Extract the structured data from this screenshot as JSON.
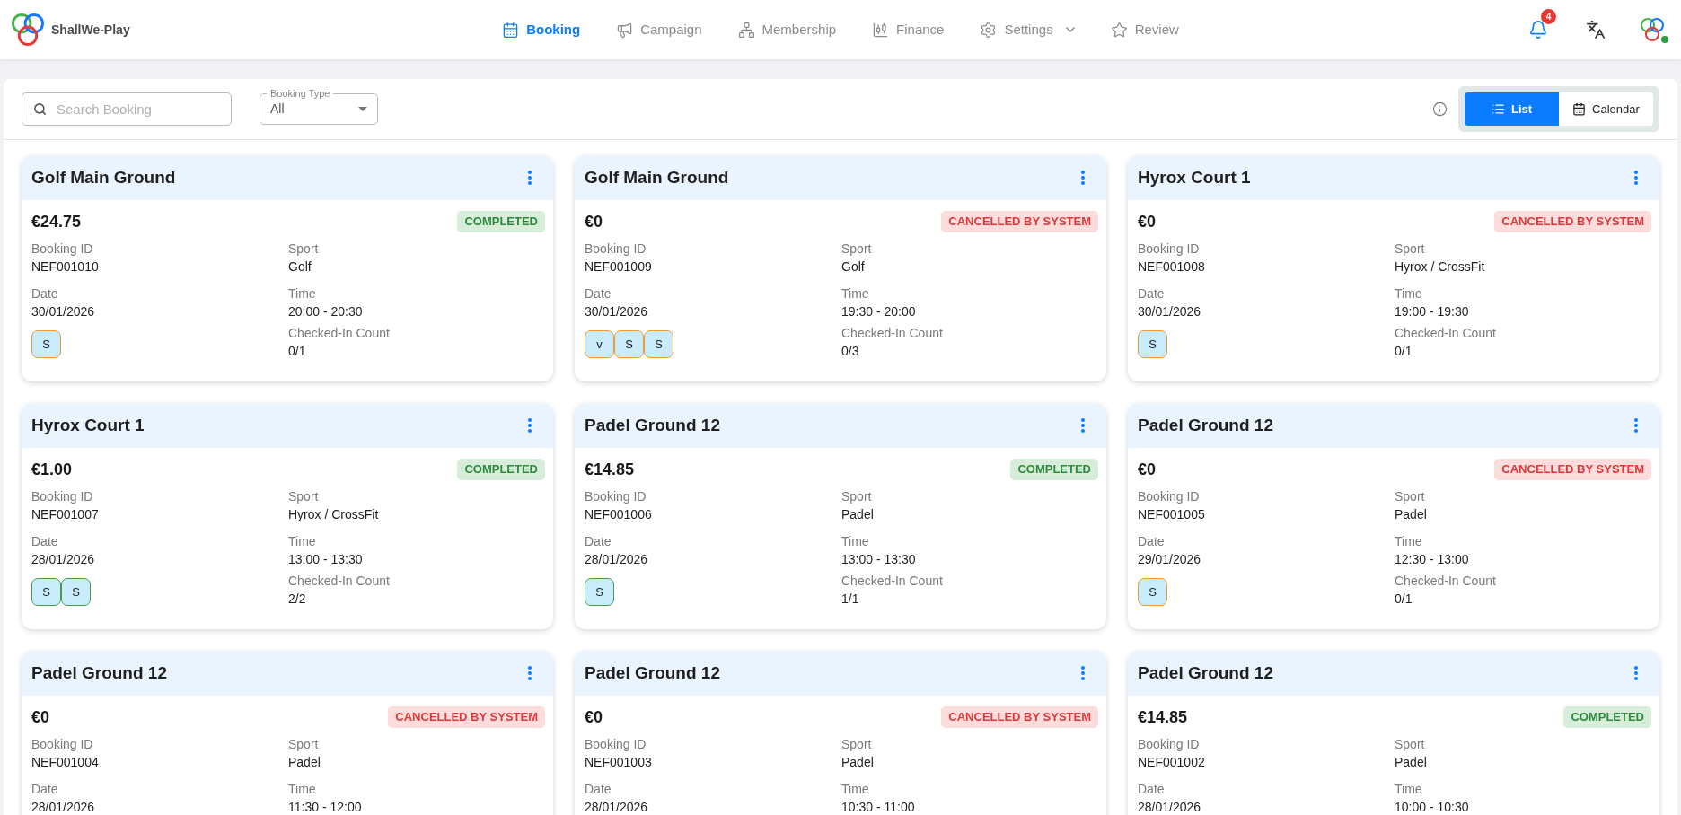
{
  "app": {
    "brand": "ShallWe-Play"
  },
  "nav": [
    {
      "label": "Booking",
      "selected": true,
      "dropdown": false
    },
    {
      "label": "Campaign",
      "selected": false,
      "dropdown": false
    },
    {
      "label": "Membership",
      "selected": false,
      "dropdown": false
    },
    {
      "label": "Finance",
      "selected": false,
      "dropdown": false
    },
    {
      "label": "Settings",
      "selected": false,
      "dropdown": true
    },
    {
      "label": "Review",
      "selected": false,
      "dropdown": false
    }
  ],
  "header_actions": {
    "notifications": {
      "count": "4"
    },
    "avatar": {
      "online": true
    }
  },
  "toolbar": {
    "search": {
      "placeholder": "Search Booking"
    },
    "booking_type": {
      "label": "Booking Type",
      "value": "All"
    },
    "views": [
      {
        "label": "List",
        "selected": true
      },
      {
        "label": "Calendar",
        "selected": false
      }
    ]
  },
  "bookings": [
    {
      "title": "Golf Main Ground",
      "price": "€24.75",
      "status": {
        "kind": "completed",
        "label": "COMPLETED"
      },
      "fields": [
        {
          "label": "Booking ID",
          "value": "NEF001010"
        },
        {
          "label": "Sport",
          "value": "Golf"
        },
        {
          "label": "Date",
          "value": "30/01/2026"
        },
        {
          "label": "Time",
          "value": "20:00 - 20:30"
        },
        {
          "label": "Checked-In Count",
          "value": "0/1"
        }
      ],
      "players": [
        {
          "initial": "S",
          "checked_in": false
        }
      ]
    },
    {
      "title": "Golf Main Ground",
      "price": "€0",
      "status": {
        "kind": "cancelled",
        "label": "CANCELLED BY SYSTEM"
      },
      "fields": [
        {
          "label": "Booking ID",
          "value": "NEF001009"
        },
        {
          "label": "Sport",
          "value": "Golf"
        },
        {
          "label": "Date",
          "value": "30/01/2026"
        },
        {
          "label": "Time",
          "value": "19:30 - 20:00"
        },
        {
          "label": "Checked-In Count",
          "value": "0/3"
        }
      ],
      "players": [
        {
          "initial": "v",
          "checked_in": false
        },
        {
          "initial": "S",
          "checked_in": false
        },
        {
          "initial": "S",
          "checked_in": false
        }
      ]
    },
    {
      "title": "Hyrox Court 1",
      "price": "€0",
      "status": {
        "kind": "cancelled",
        "label": "CANCELLED BY SYSTEM"
      },
      "fields": [
        {
          "label": "Booking ID",
          "value": "NEF001008"
        },
        {
          "label": "Sport",
          "value": "Hyrox / CrossFit"
        },
        {
          "label": "Date",
          "value": "30/01/2026"
        },
        {
          "label": "Time",
          "value": "19:00 - 19:30"
        },
        {
          "label": "Checked-In Count",
          "value": "0/1"
        }
      ],
      "players": [
        {
          "initial": "S",
          "checked_in": false
        }
      ]
    },
    {
      "title": "Hyrox Court 1",
      "price": "€1.00",
      "status": {
        "kind": "completed",
        "label": "COMPLETED"
      },
      "fields": [
        {
          "label": "Booking ID",
          "value": "NEF001007"
        },
        {
          "label": "Sport",
          "value": "Hyrox / CrossFit"
        },
        {
          "label": "Date",
          "value": "28/01/2026"
        },
        {
          "label": "Time",
          "value": "13:00 - 13:30"
        },
        {
          "label": "Checked-In Count",
          "value": "2/2"
        }
      ],
      "players": [
        {
          "initial": "S",
          "checked_in": true
        },
        {
          "initial": "S",
          "checked_in": true
        }
      ]
    },
    {
      "title": "Padel Ground 12",
      "price": "€14.85",
      "status": {
        "kind": "completed",
        "label": "COMPLETED"
      },
      "fields": [
        {
          "label": "Booking ID",
          "value": "NEF001006"
        },
        {
          "label": "Sport",
          "value": "Padel"
        },
        {
          "label": "Date",
          "value": "28/01/2026"
        },
        {
          "label": "Time",
          "value": "13:00 - 13:30"
        },
        {
          "label": "Checked-In Count",
          "value": "1/1"
        }
      ],
      "players": [
        {
          "initial": "S",
          "checked_in": true
        }
      ]
    },
    {
      "title": "Padel Ground 12",
      "price": "€0",
      "status": {
        "kind": "cancelled",
        "label": "CANCELLED BY SYSTEM"
      },
      "fields": [
        {
          "label": "Booking ID",
          "value": "NEF001005"
        },
        {
          "label": "Sport",
          "value": "Padel"
        },
        {
          "label": "Date",
          "value": "29/01/2026"
        },
        {
          "label": "Time",
          "value": "12:30 - 13:00"
        },
        {
          "label": "Checked-In Count",
          "value": "0/1"
        }
      ],
      "players": [
        {
          "initial": "S",
          "checked_in": false
        }
      ]
    },
    {
      "title": "Padel Ground 12",
      "price": "€0",
      "status": {
        "kind": "cancelled",
        "label": "CANCELLED BY SYSTEM"
      },
      "fields": [
        {
          "label": "Booking ID",
          "value": "NEF001004"
        },
        {
          "label": "Sport",
          "value": "Padel"
        },
        {
          "label": "Date",
          "value": "28/01/2026"
        },
        {
          "label": "Time",
          "value": "11:30 - 12:00"
        }
      ]
    },
    {
      "title": "Padel Ground 12",
      "price": "€0",
      "status": {
        "kind": "cancelled",
        "label": "CANCELLED BY SYSTEM"
      },
      "fields": [
        {
          "label": "Booking ID",
          "value": "NEF001003"
        },
        {
          "label": "Sport",
          "value": "Padel"
        },
        {
          "label": "Date",
          "value": "28/01/2026"
        },
        {
          "label": "Time",
          "value": "10:30 - 11:00"
        }
      ]
    },
    {
      "title": "Padel Ground 12",
      "price": "€14.85",
      "status": {
        "kind": "completed",
        "label": "COMPLETED"
      },
      "fields": [
        {
          "label": "Booking ID",
          "value": "NEF001002"
        },
        {
          "label": "Sport",
          "value": "Padel"
        },
        {
          "label": "Date",
          "value": "28/01/2026"
        },
        {
          "label": "Time",
          "value": "10:00 - 10:30"
        }
      ]
    }
  ]
}
